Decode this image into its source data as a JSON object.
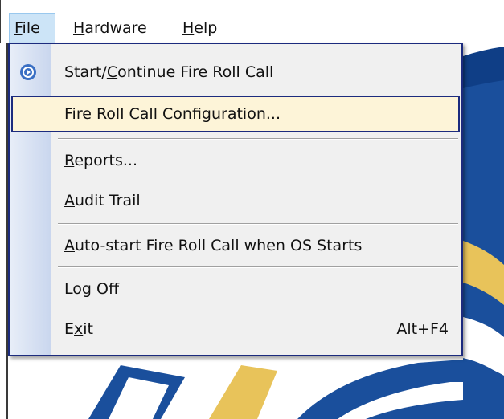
{
  "menubar": {
    "file": {
      "pre": "",
      "u": "F",
      "post": "ile"
    },
    "hardware": {
      "pre": "",
      "u": "H",
      "post": "ardware"
    },
    "help": {
      "pre": "",
      "u": "H",
      "post": "elp"
    }
  },
  "file_menu": {
    "items": [
      {
        "pre": "Start/",
        "u": "C",
        "post": "ontinue Fire Roll Call",
        "shortcut": "",
        "icon": "play-circle-icon"
      },
      {
        "pre": "",
        "u": "F",
        "post": "ire Roll Call Configuration...",
        "shortcut": "",
        "highlighted": true
      },
      {
        "pre": "",
        "u": "R",
        "post": "eports...",
        "shortcut": ""
      },
      {
        "pre": "",
        "u": "A",
        "post": "udit Trail",
        "shortcut": ""
      },
      {
        "pre": "",
        "u": "A",
        "post": "uto-start Fire Roll Call when OS Starts",
        "shortcut": ""
      },
      {
        "pre": "",
        "u": "L",
        "post": "og Off",
        "shortcut": ""
      },
      {
        "pre": "E",
        "u": "x",
        "post": "it",
        "shortcut": "Alt+F4"
      }
    ]
  },
  "colors": {
    "menu_border": "#1c2b7e",
    "highlight_bg": "#fdf4d8",
    "active_title_bg": "#cce4f7",
    "bg_blue": "#1a4f9c",
    "bg_gold": "#e8c35a"
  }
}
